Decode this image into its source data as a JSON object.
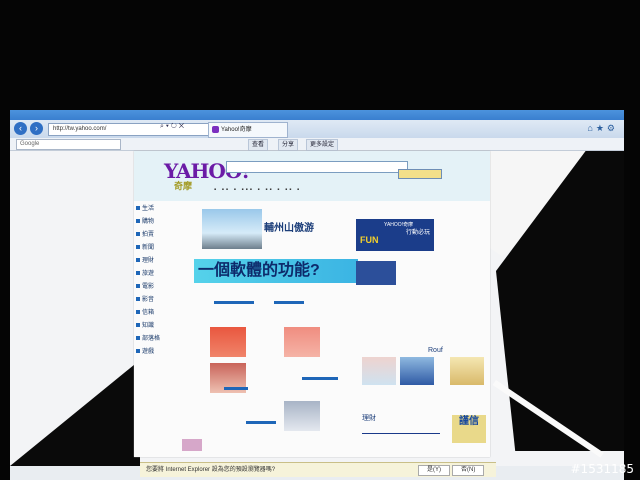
{
  "browser": {
    "address": "http://tw.yahoo.com/",
    "tab_label": "Yahoo!奇摩",
    "toolbar_search_placeholder": "Google",
    "toolbar_items": [
      "查看",
      "分享",
      "更多設定"
    ]
  },
  "page": {
    "logo_text": "YAHOO!",
    "logo_sub": "奇摩",
    "hero_title": "輔州山傲游",
    "banner_text": "一個軟體的功能?",
    "ad_fun": "FUN",
    "ad_label": "行動必玩",
    "ad_brand": "YAHOO!奇摩",
    "right_title": "Rouf",
    "finance_title": "理財",
    "jinxin": "謹信",
    "left_items": [
      "生活",
      "購物",
      "拍賣",
      "新聞",
      "理財",
      "旅遊",
      "電影",
      "影音",
      "信箱",
      "知識",
      "部落格",
      "遊戲"
    ]
  },
  "infobar": {
    "message": "您要將 Internet Explorer 設為您的預設瀏覽器嗎?",
    "yes_label": "是(Y)",
    "no_label": "否(N)"
  },
  "watermark": "#1531185",
  "colors": {
    "ie_blue": "#3a7fcf",
    "yahoo_purple": "#6b1ba6",
    "banner_cyan": "#3bb4e3"
  }
}
